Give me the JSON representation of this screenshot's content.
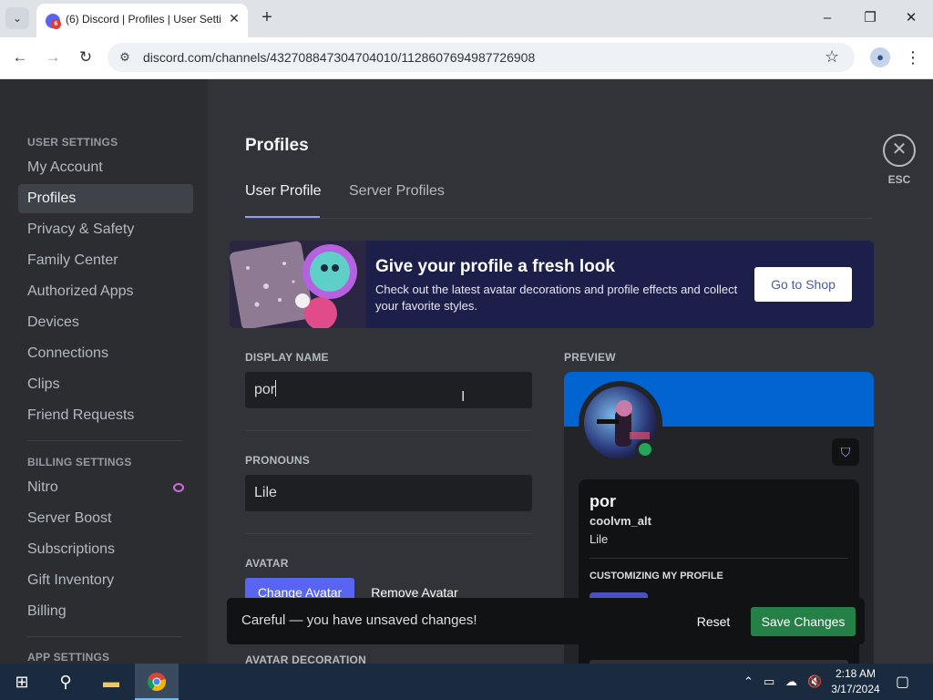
{
  "browser": {
    "tab_title": "(6) Discord | Profiles | User Setti",
    "tab_badge": "6",
    "url": "discord.com/channels/432708847304704010/1128607694987726908"
  },
  "sidebar": {
    "user_settings_header": "USER SETTINGS",
    "user_items": [
      {
        "label": "My Account"
      },
      {
        "label": "Profiles"
      },
      {
        "label": "Privacy & Safety"
      },
      {
        "label": "Family Center"
      },
      {
        "label": "Authorized Apps"
      },
      {
        "label": "Devices"
      },
      {
        "label": "Connections"
      },
      {
        "label": "Clips"
      },
      {
        "label": "Friend Requests"
      }
    ],
    "billing_settings_header": "BILLING SETTINGS",
    "billing_items": [
      {
        "label": "Nitro"
      },
      {
        "label": "Server Boost"
      },
      {
        "label": "Subscriptions"
      },
      {
        "label": "Gift Inventory"
      },
      {
        "label": "Billing"
      }
    ],
    "app_settings_header": "APP SETTINGS"
  },
  "main": {
    "title": "Profiles",
    "tabs": [
      {
        "label": "User Profile",
        "active": true
      },
      {
        "label": "Server Profiles",
        "active": false
      }
    ],
    "banner": {
      "title": "Give your profile a fresh look",
      "text": "Check out the latest avatar decorations and profile effects and collect your favorite styles.",
      "button": "Go to Shop"
    },
    "display_name": {
      "label": "DISPLAY NAME",
      "value": "por"
    },
    "pronouns": {
      "label": "PRONOUNS",
      "value": "Lile"
    },
    "avatar": {
      "label": "AVATAR",
      "change_button": "Change Avatar",
      "remove_button": "Remove Avatar"
    },
    "avatar_decoration_label": "AVATAR DECORATION"
  },
  "preview": {
    "label": "PREVIEW",
    "name": "por",
    "username": "coolvm_alt",
    "pronouns": "Lile",
    "section": "CUSTOMIZING MY PROFILE",
    "banner_color": "#0065d1"
  },
  "close": {
    "label": "ESC"
  },
  "unsaved": {
    "message": "Careful — you have unsaved changes!",
    "reset": "Reset",
    "save": "Save Changes"
  },
  "taskbar": {
    "time": "2:18 AM",
    "date": "3/17/2024"
  },
  "colors": {
    "accent": "#5865f2",
    "save_green": "#248046",
    "online": "#23a55a"
  }
}
